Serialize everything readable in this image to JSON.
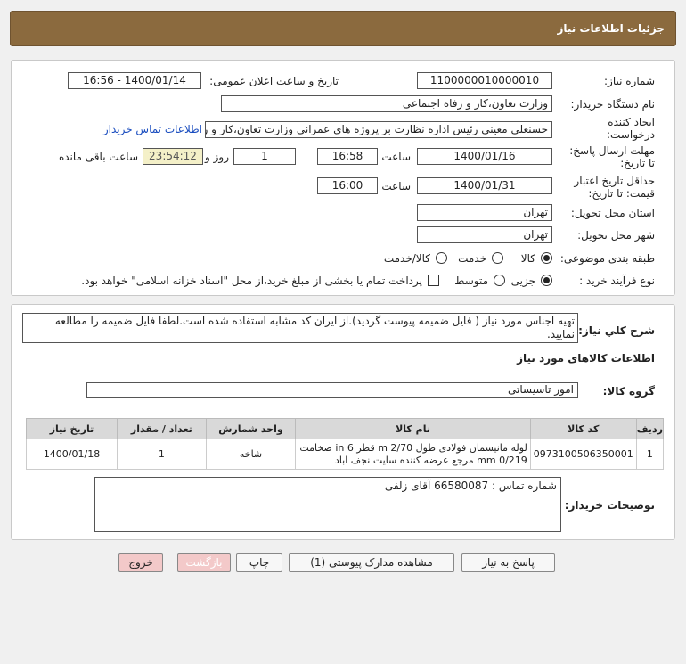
{
  "header": {
    "title": "جزئیات اطلاعات نیاز"
  },
  "details": {
    "need_number_label": "شماره نیاز:",
    "need_number": "1100000010000010",
    "announce_label": "تاریخ و ساعت اعلان عمومی:",
    "announce_value": "1400/01/14 - 16:56",
    "buyer_org_label": "نام دستگاه خریدار:",
    "buyer_org": "وزارت تعاون،کار و رفاه اجتماعی",
    "requester_label_1": "ایجاد کننده",
    "requester_label_2": "درخواست:",
    "requester": "حسنعلی معینی رئیس اداره نظارت بر پروژه های عمرانی وزارت تعاون،کار و رفاه اجتماعی",
    "contact_link": "اطلاعات تماس خریدار",
    "deadline_label_1": "مهلت ارسال پاسخ:",
    "deadline_label_2": "تا تاریخ:",
    "deadline_date": "1400/01/16",
    "time_label": "ساعت",
    "deadline_time": "16:58",
    "days_value": "1",
    "days_label": "روز و",
    "remaining_time": "23:54:12",
    "remaining_label": "ساعت باقی مانده",
    "validity_label_1": "حداقل تاریخ اعتبار",
    "validity_label_2": "قیمت: تا تاریخ:",
    "validity_date": "1400/01/31",
    "validity_time": "16:00",
    "province_label": "استان محل تحویل:",
    "province": "تهران",
    "city_label": "شهر محل تحویل:",
    "city": "تهران",
    "category_label": "طبقه بندی موضوعی:",
    "category_options": [
      "کالا",
      "خدمت",
      "کالا/خدمت"
    ],
    "process_label": "نوع فرآیند خرید :",
    "process_options": [
      "جزیی",
      "متوسط"
    ],
    "payment_note": "پرداخت تمام یا بخشی از مبلغ خرید،از محل \"اسناد خزانه اسلامی\" خواهد بود."
  },
  "description": {
    "label": "شرح کلي نياز:",
    "text": "تهیه اجناس مورد نیاز ( فایل ضمیمه پیوست گردید).از ایران کد مشابه استفاده شده است.لطفا فایل ضمیمه را مطالعه نمایید."
  },
  "goods": {
    "section_title": "اطلاعات کالاهای مورد نیاز",
    "group_label": "گروه کالا:",
    "group_value": "امور تاسیساتی",
    "columns": [
      "ردیف",
      "کد کالا",
      "نام کالا",
      "واحد شمارش",
      "تعداد / مقدار",
      "تاریخ نیاز"
    ],
    "rows": [
      {
        "index": "1",
        "code": "0973100506350001",
        "name": "لوله مانیسمان فولادی طول m 2/70 قطر in 6 ضخامت 0/219 mm مرجع عرضه کننده سایت نجف اباد",
        "unit": "شاخه",
        "qty": "1",
        "date": "1400/01/18"
      }
    ]
  },
  "buyer_notes": {
    "label": "توضیحات خریدار:",
    "text": "شماره تماس : 66580087 آقای زلفی"
  },
  "buttons": {
    "reply": "پاسخ به نیاز",
    "docs": "مشاهده مدارک پیوستی (1)",
    "print": "چاپ",
    "back": "بازگشت",
    "exit": "خروج"
  }
}
